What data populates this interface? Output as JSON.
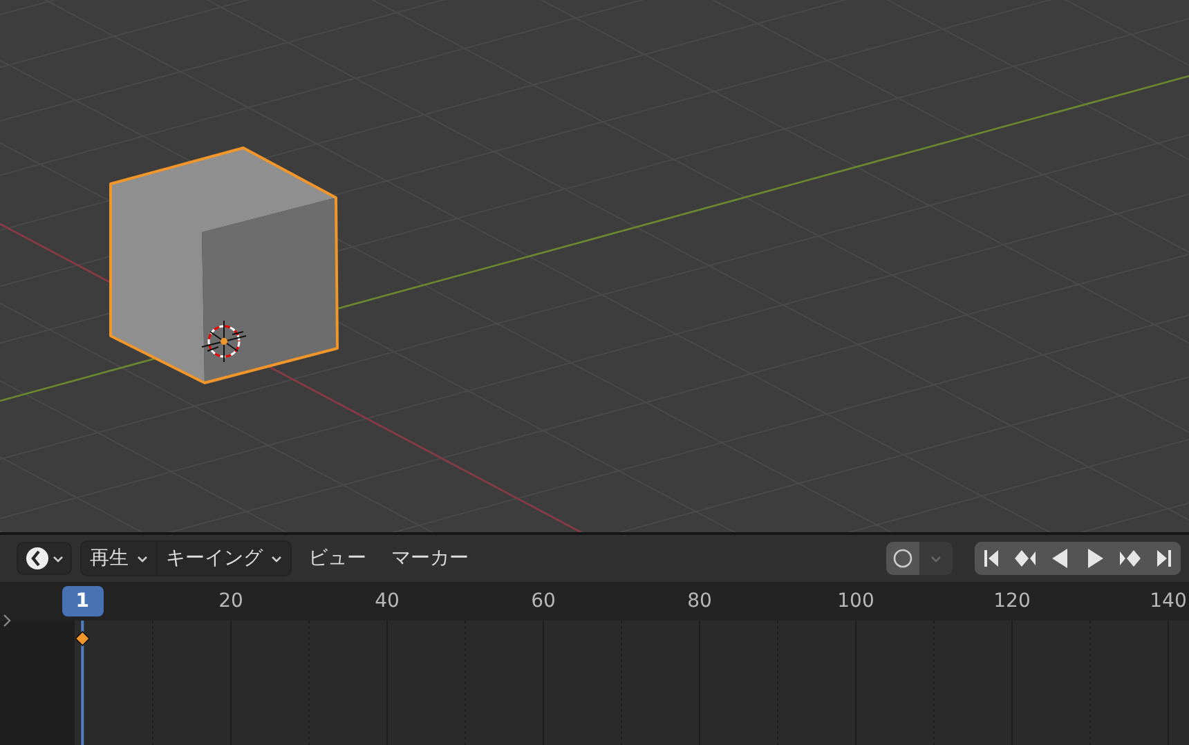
{
  "viewport": {
    "object_selected": true
  },
  "timeline_header": {
    "menus": [
      {
        "label": "再生",
        "dropdown": true
      },
      {
        "label": "キーイング",
        "dropdown": true
      },
      {
        "label": "ビュー",
        "dropdown": false
      },
      {
        "label": "マーカー",
        "dropdown": false
      }
    ],
    "auto_keying": {
      "on": false
    },
    "playback_buttons": [
      {
        "kind": "jump_start"
      },
      {
        "kind": "prev_key"
      },
      {
        "kind": "play_reverse"
      },
      {
        "kind": "play"
      },
      {
        "kind": "next_key"
      },
      {
        "kind": "jump_end"
      }
    ]
  },
  "ruler": {
    "current_frame": "1",
    "ticks": [
      "20",
      "40",
      "60",
      "80",
      "100",
      "120",
      "140"
    ]
  },
  "keyframe": {
    "selected": true
  }
}
